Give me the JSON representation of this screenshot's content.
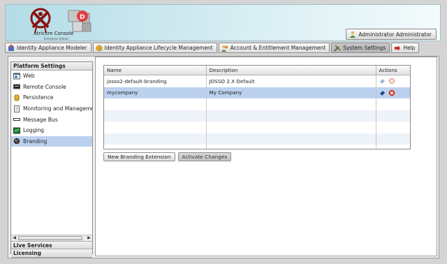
{
  "header": {
    "brand": "Atricore Console",
    "edition": "Enterprise Edition",
    "user_button": "Administrator Administrator"
  },
  "tabs": [
    {
      "label": "Identity Appliance Modeler",
      "icon": "appliance-icon"
    },
    {
      "label": "Identity Appliance Lifecycle Management",
      "icon": "lifecycle-icon"
    },
    {
      "label": "Account & Entitlement Management",
      "icon": "users-icon"
    },
    {
      "label": "System Settings",
      "icon": "tools-icon",
      "active": true
    },
    {
      "label": "Help",
      "icon": "help-icon"
    }
  ],
  "sidebar": {
    "section_title": "Platform Settings",
    "items": [
      {
        "label": "Web",
        "icon": "web-icon"
      },
      {
        "label": "Remote Console",
        "icon": "console-icon"
      },
      {
        "label": "Persistence",
        "icon": "database-icon"
      },
      {
        "label": "Monitoring and Management",
        "icon": "monitoring-icon"
      },
      {
        "label": "Message Bus",
        "icon": "message-bus-icon"
      },
      {
        "label": "Logging",
        "icon": "logging-icon"
      },
      {
        "label": "Branding",
        "icon": "branding-icon",
        "selected": true
      }
    ],
    "bottom_sections": [
      "Live Services",
      "Licensing"
    ]
  },
  "grid": {
    "columns": [
      "Name",
      "Description",
      "Actions"
    ],
    "rows": [
      {
        "name": "josso2-default-branding",
        "description": "JOSSO 2.X Default"
      },
      {
        "name": "mycompany",
        "description": "My Company",
        "selected": true
      }
    ]
  },
  "actions": {
    "new_label": "New Branding Extension",
    "activate_label": "Activate Changes"
  }
}
